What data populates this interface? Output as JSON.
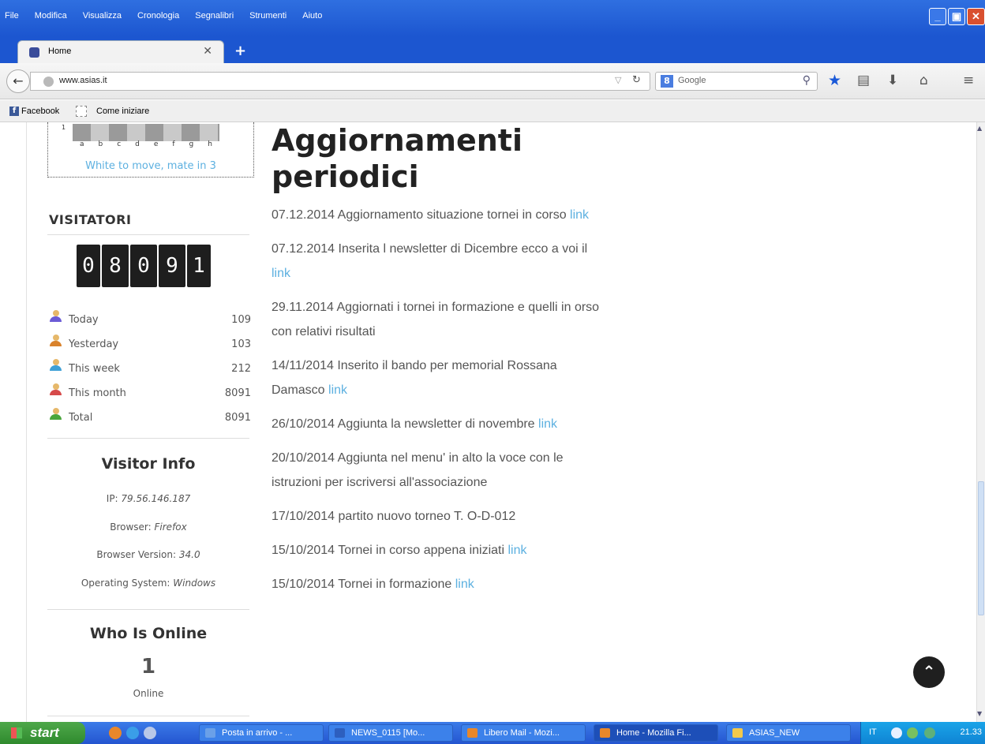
{
  "window": {
    "menu": [
      "File",
      "Modifica",
      "Visualizza",
      "Cronologia",
      "Segnalibri",
      "Strumenti",
      "Aiuto"
    ],
    "min_label": "_",
    "max_label": "▣",
    "close_label": "✕"
  },
  "tabs": [
    {
      "label": "Home",
      "close": "✕"
    }
  ],
  "newtab_label": "+",
  "navbar": {
    "url": "www.asias.it",
    "search_placeholder": "Google",
    "search_engine_badge": "8"
  },
  "bookmarks": [
    {
      "label": "Facebook",
      "icon": "facebook-icon"
    },
    {
      "label": "Come iniziare",
      "icon": "page-icon"
    }
  ],
  "chess": {
    "rank": "1",
    "files": [
      "a",
      "b",
      "c",
      "d",
      "e",
      "f",
      "g",
      "h"
    ],
    "caption": "White to move, mate in 3"
  },
  "sidebar": {
    "visitatori_title": "VISITATORI",
    "counter_digits": [
      "0",
      "8",
      "0",
      "9",
      "1"
    ],
    "stats": [
      {
        "label": "Today",
        "value": "109",
        "color": "#6b5bd6"
      },
      {
        "label": "Yesterday",
        "value": "103",
        "color": "#d9822b"
      },
      {
        "label": "This week",
        "value": "212",
        "color": "#3fa0d6"
      },
      {
        "label": "This month",
        "value": "8091",
        "color": "#d64a4a"
      },
      {
        "label": "Total",
        "value": "8091",
        "color": "#4aa63c"
      }
    ],
    "visitor_info_title": "Visitor Info",
    "ip_label": "IP: ",
    "ip_value": "79.56.146.187",
    "browser_label": "Browser: ",
    "browser_value": "Firefox",
    "version_label": "Browser Version: ",
    "version_value": "34.0",
    "os_label": "Operating System: ",
    "os_value": "Windows",
    "who_online_title": "Who Is Online",
    "online_count": "1",
    "online_label": "Online"
  },
  "main": {
    "title": "Aggiornamenti periodici",
    "news": [
      {
        "text": "07.12.2014 Aggiornamento situazione tornei in corso ",
        "link": "link"
      },
      {
        "text": "07.12.2014  Inserita l newsletter di Dicembre ecco a voi il ",
        "link": "link"
      },
      {
        "text": "29.11.2014 Aggiornati i tornei in formazione e quelli in orso con relativi risultati",
        "link": ""
      },
      {
        "text": "14/11/2014 Inserito il bando per memorial Rossana Damasco ",
        "link": "link"
      },
      {
        "text": "26/10/2014 Aggiunta la newsletter di novembre ",
        "link": "link"
      },
      {
        "text": "20/10/2014  Aggiunta nel menu' in alto la voce con le istruzioni  per iscriversi all'associazione",
        "link": ""
      },
      {
        "text": "17/10/2014 partito nuovo torneo T. O-D-012",
        "link": ""
      },
      {
        "text": "15/10/2014 Tornei in corso appena iniziati ",
        "link": "link"
      },
      {
        "text": " 15/10/2014 Tornei in formazione  ",
        "link": "link"
      }
    ]
  },
  "totop_label": "⌃",
  "taskbar": {
    "start_label": "start",
    "tasks": [
      {
        "label": "Posta in arrivo - ...",
        "color": "#6aa0e8",
        "active": false
      },
      {
        "label": "NEWS_0115 [Mo...",
        "color": "#2d5fbf",
        "active": false
      },
      {
        "label": "Libero Mail - Mozi...",
        "color": "#e8872b",
        "active": false
      },
      {
        "label": "Home - Mozilla Fi...",
        "color": "#e8872b",
        "active": true
      },
      {
        "label": "ASIAS_NEW",
        "color": "#f2c94c",
        "active": false
      }
    ],
    "lang": "IT",
    "clock": "21.33"
  }
}
